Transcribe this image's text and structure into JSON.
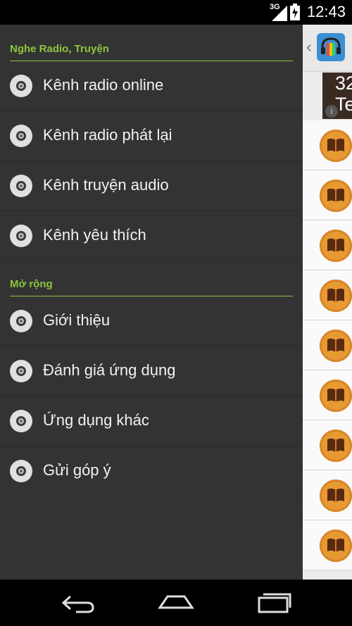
{
  "status_bar": {
    "network": "3G",
    "time": "12:43"
  },
  "drawer": {
    "sections": [
      {
        "header": "Nghe Radio, Truyện",
        "items": [
          "Kênh radio online",
          "Kênh radio phát lại",
          "Kênh truyện audio",
          "Kênh yêu thích"
        ]
      },
      {
        "header": "Mở rộng",
        "items": [
          "Giới thiệu",
          "Đánh giá ứng dụng",
          "Ứng dụng khác",
          "Gửi góp ý"
        ]
      }
    ]
  },
  "background_app": {
    "banner_text": "32 Te",
    "banner_line1": "32",
    "banner_line2": "Te"
  },
  "colors": {
    "accent": "#8cc63f",
    "drawer_bg": "#333333",
    "book_icon": "#e89a32"
  },
  "icons": {
    "menu_item": "disc-icon",
    "nav": [
      "back-icon",
      "home-icon",
      "recents-icon"
    ]
  }
}
